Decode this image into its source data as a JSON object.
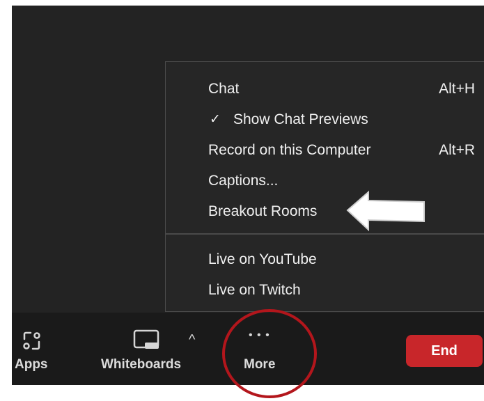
{
  "menu": {
    "items": [
      {
        "label": "Chat",
        "shortcut": "Alt+H"
      },
      {
        "label": "Show Chat Previews",
        "checked": true
      },
      {
        "label": "Record on this Computer",
        "shortcut": "Alt+R"
      },
      {
        "label": "Captions..."
      },
      {
        "label": "Breakout Rooms"
      },
      {
        "label": "Live on YouTube"
      },
      {
        "label": "Live on Twitch"
      }
    ],
    "check_glyph": "✓"
  },
  "toolbar": {
    "apps_label": "Apps",
    "whiteboards_label": "Whiteboards",
    "caret_glyph": "^",
    "more_label": "More",
    "more_glyph": "• • •",
    "end_label": "End"
  },
  "colors": {
    "end_button": "#c8262a",
    "annotation_circle": "#b3161c",
    "annotation_arrow": "#ffffff"
  },
  "icons": {
    "apps": "apps-icon",
    "whiteboard": "whiteboard-icon",
    "caret": "caret-up-icon",
    "more": "more-dots-icon",
    "check": "checkmark-icon"
  }
}
